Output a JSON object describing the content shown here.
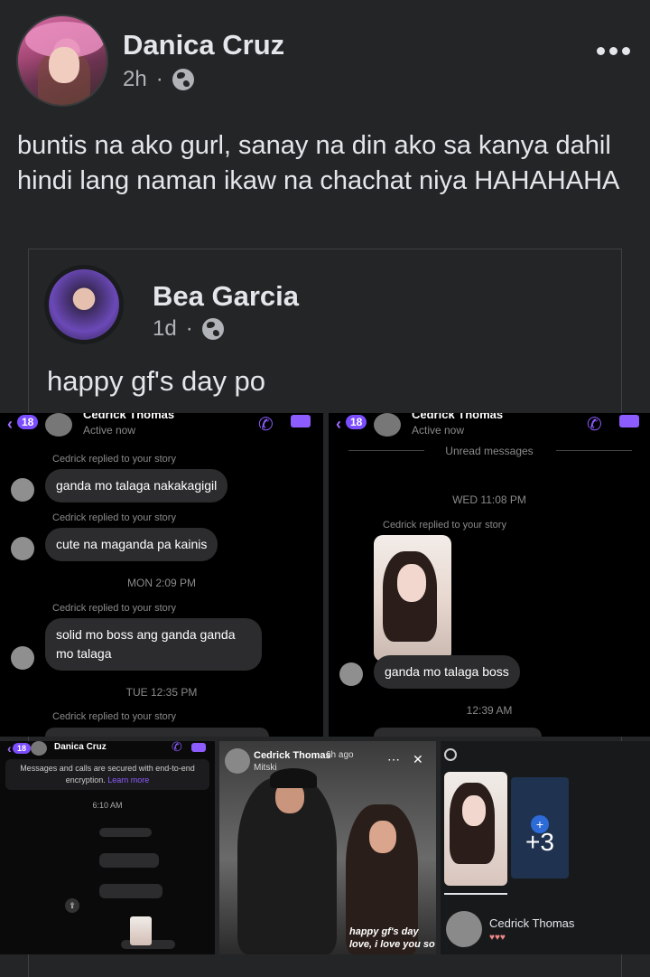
{
  "post": {
    "author": "Danica Cruz",
    "time": "2h",
    "separator": "·",
    "text": "buntis na ako gurl, sanay na din ako sa kanya dahil hindi lang naman ikaw na chachat niya HAHAHAHA"
  },
  "shared": {
    "author": "Bea Garcia",
    "time": "1d",
    "separator": "·",
    "text": "happy gf's day po"
  },
  "chat1": {
    "badge": "18",
    "contact": "Cedrick Thomas",
    "status": "Active now",
    "replied": "Cedrick replied to your story",
    "msg1": "ganda mo talaga nakakagigil",
    "msg2": "cute na maganda pa kainis",
    "time1": "MON 2:09 PM",
    "msg3a": "solid mo boss ang ganda ganda",
    "msg3b": "mo talaga",
    "time2": "TUE 12:35 PM"
  },
  "chat2": {
    "badge": "18",
    "contact": "Cedrick Thomas",
    "status": "Active now",
    "unread": "Unread messages",
    "time1": "WED 11:08 PM",
    "replied": "Cedrick replied to your story",
    "msg1": "ganda mo talaga boss",
    "time2": "12:39 AM"
  },
  "chat3": {
    "badge": "18",
    "contact": "Danica Cruz",
    "encryption": "Messages and calls are secured with end-to-end encryption.",
    "learn_more": "Learn more",
    "time": "6:10 AM"
  },
  "story": {
    "name": "Cedrick Thomas",
    "time": "6h ago",
    "music": "Mitski",
    "caption": "happy gf's day love, i love you so"
  },
  "viewers": {
    "more": "+3",
    "viewer": "Cedrick Thomas",
    "hearts": "♥♥♥"
  },
  "colors": {
    "bg": "#242526",
    "text": "#e4e6eb",
    "muted": "#b0b3b8",
    "messenger": "#8c5cff"
  }
}
